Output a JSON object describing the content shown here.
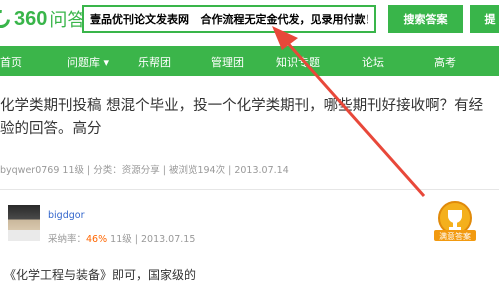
{
  "header": {
    "logo_text": "360",
    "logo_text2": "问答",
    "search_value": "壹品优刊论文发表网   合作流程无定金代发，见录用付款！",
    "search_button": "搜索答案",
    "extra_button": "提"
  },
  "nav": {
    "items": [
      "首页",
      "问题库 ▾",
      "乐帮团",
      "管理团",
      "知识专题",
      "论坛",
      "高考"
    ]
  },
  "question": {
    "title": "化学类期刊投稿 想混个毕业，投一个化学类期刊，哪些期刊好接收啊？有经验的回答。高分",
    "meta": "byqwer0769  11级 | 分类：资源分享 | 被浏览194次 | 2013.07.14"
  },
  "answer": {
    "username": "bigdgor",
    "rate_label": "采纳率：",
    "rate_value": "46%",
    "rate_rest": "  11级 | 2013.07.15",
    "badge_text": "满意答案",
    "text": "《化学工程与装备》即可，国家级的"
  },
  "colors": {
    "brand": "#39b54a",
    "arrow": "#e8483a",
    "badge": "#f29a10"
  }
}
